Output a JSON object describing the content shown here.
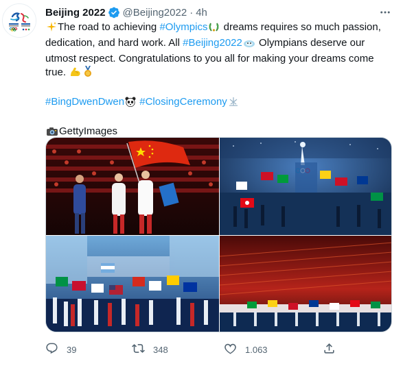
{
  "author": {
    "name": "Beijing 2022",
    "handle": "@Beijing2022",
    "separator": "·",
    "time": "4h",
    "avatar_icon": "beijing-2022-emblem"
  },
  "tweet": {
    "line1_prefix": "The road to achieving ",
    "hashtag_olympics": "#Olympics",
    "line1_suffix": " dreams requires so much passion, dedication, and hard work. All ",
    "hashtag_beijing": "#Beijing2022",
    "line1_end": " Olympians deserve our utmost respect. Congratulations to you all for making your dreams come true.",
    "hashtag_bingdwendwen": "#BingDwenDwen",
    "hashtag_closing": "#ClosingCeremony",
    "credit": "GettyImages"
  },
  "emoji": [
    "sparkles-icon",
    "laurel-icon",
    "olympic-mascot-icon",
    "flexed-biceps-icon",
    "medal-icon",
    "panda-icon",
    "snowflake-icon",
    "camera-icon"
  ],
  "media": [
    {
      "alt": "flag-bearers"
    },
    {
      "alt": "stadium-flags"
    },
    {
      "alt": "athletes-parade"
    },
    {
      "alt": "stadium-overview"
    }
  ],
  "actions": {
    "replies": "39",
    "retweets": "348",
    "likes": "1.063"
  },
  "colors": {
    "link": "#1d9bf0",
    "text": "#0f1419",
    "muted": "#536471",
    "border": "#cfd9de"
  }
}
